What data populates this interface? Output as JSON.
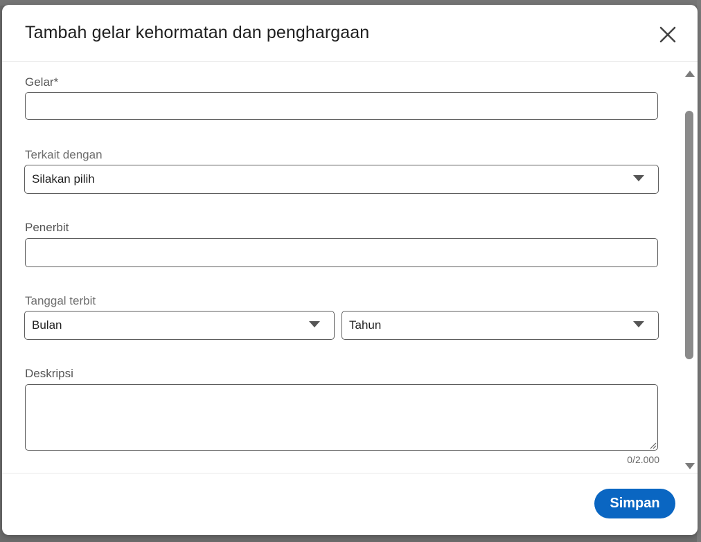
{
  "dialog": {
    "title": "Tambah gelar kehormatan dan penghargaan",
    "close_icon": "close-icon"
  },
  "form": {
    "title_field": {
      "label": "Gelar*",
      "value": ""
    },
    "associated_with": {
      "label": "Terkait dengan",
      "selected": "Silakan pilih"
    },
    "issuer": {
      "label": "Penerbit",
      "value": ""
    },
    "issue_date": {
      "label": "Tanggal terbit",
      "month_selected": "Bulan",
      "year_selected": "Tahun"
    },
    "description": {
      "label": "Deskripsi",
      "value": "",
      "char_count": "0/2.000"
    }
  },
  "footer": {
    "save_label": "Simpan"
  },
  "colors": {
    "primary_button": "#0a66c2",
    "border": "#5c5c5c"
  }
}
